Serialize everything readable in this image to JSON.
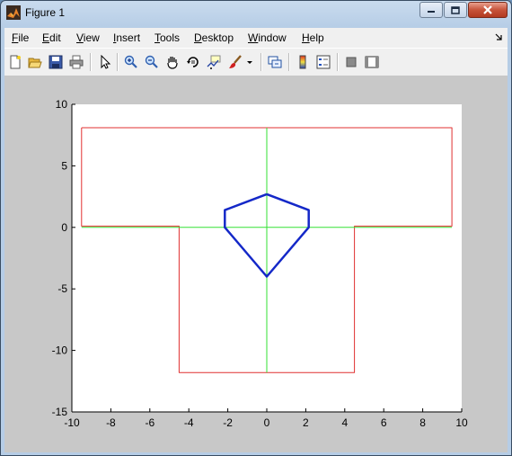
{
  "window": {
    "title": "Figure 1"
  },
  "menu": [
    {
      "label": "File",
      "key": "F",
      "rest": "ile"
    },
    {
      "label": "Edit",
      "key": "E",
      "rest": "dit"
    },
    {
      "label": "View",
      "key": "V",
      "rest": "iew"
    },
    {
      "label": "Insert",
      "key": "I",
      "rest": "nsert"
    },
    {
      "label": "Tools",
      "key": "T",
      "rest": "ools"
    },
    {
      "label": "Desktop",
      "key": "D",
      "rest": "esktop"
    },
    {
      "label": "Window",
      "key": "W",
      "rest": "indow"
    },
    {
      "label": "Help",
      "key": "H",
      "rest": "elp"
    }
  ],
  "toolbar_icons": [
    "new-figure-icon",
    "open-file-icon",
    "save-icon",
    "print-icon",
    "edit-plot-arrow-icon",
    "zoom-in-icon",
    "zoom-out-icon",
    "pan-hand-icon",
    "rotate-3d-icon",
    "data-cursor-icon",
    "brush-icon",
    "brush-dropdown-icon",
    "link-plot-icon",
    "colorbar-icon",
    "legend-icon",
    "hide-plot-tools-icon",
    "show-plot-tools-icon"
  ],
  "colors": {
    "outline": "#e03030",
    "axes_cross": "#33e033",
    "shape": "#1428c8"
  },
  "chart_data": {
    "type": "line",
    "xlim": [
      -10,
      10
    ],
    "ylim": [
      -15,
      10
    ],
    "xticks": [
      -10,
      -8,
      -6,
      -4,
      -2,
      0,
      2,
      4,
      6,
      8,
      10
    ],
    "yticks": [
      10,
      5,
      0,
      -5,
      -10,
      -15
    ],
    "xtick_labels": [
      "-10",
      "-8",
      "-6",
      "-4",
      "-2",
      "0",
      "2",
      "4",
      "6",
      "8",
      "10"
    ],
    "ytick_labels": [
      "10",
      "5",
      "0",
      "-5",
      "-10",
      "-15"
    ],
    "grid": false,
    "series": [
      {
        "color": "#e03030",
        "width": 1,
        "x": [
          -9.5,
          9.5,
          9.5,
          4.5,
          4.5,
          -4.5,
          -4.5,
          -9.5,
          -9.5
        ],
        "y": [
          8.1,
          8.1,
          0.1,
          0.1,
          -11.8,
          -11.8,
          0.1,
          0.1,
          8.1
        ]
      },
      {
        "color": "#33e033",
        "width": 1,
        "x": [
          -9.5,
          9.5
        ],
        "y": [
          0,
          0
        ]
      },
      {
        "color": "#33e033",
        "width": 1,
        "x": [
          0,
          0
        ],
        "y": [
          8.1,
          -11.8
        ]
      },
      {
        "color": "#1428c8",
        "width": 2.5,
        "x": [
          0,
          2.15,
          2.15,
          0,
          -2.15,
          -2.15,
          0
        ],
        "y": [
          2.7,
          1.4,
          0,
          -4,
          0,
          1.4,
          2.7
        ]
      }
    ]
  }
}
